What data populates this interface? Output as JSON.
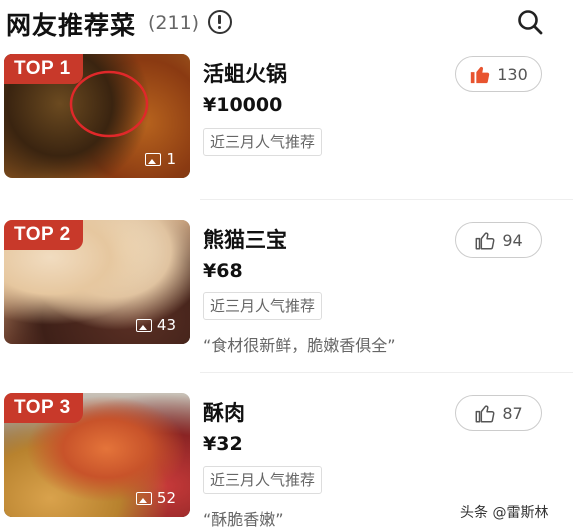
{
  "header": {
    "title": "网友推荐菜",
    "count": "(211)",
    "info_icon": "info-circle-icon",
    "search_icon": "search-icon"
  },
  "dishes": [
    {
      "rank": "TOP 1",
      "name": "活蛆火锅",
      "price": "¥10000",
      "tag": "近三月人气推荐",
      "quote": "",
      "photo_count": "1",
      "likes": "130",
      "liked": true
    },
    {
      "rank": "TOP 2",
      "name": "熊猫三宝",
      "price": "¥68",
      "tag": "近三月人气推荐",
      "quote": "“食材很新鲜，脆嫩香俱全”",
      "photo_count": "43",
      "likes": "94",
      "liked": false
    },
    {
      "rank": "TOP 3",
      "name": "酥肉",
      "price": "¥32",
      "tag": "近三月人气推荐",
      "quote": "“酥脆香嫩”",
      "photo_count": "52",
      "likes": "87",
      "liked": false
    }
  ],
  "watermark": "头条 @雷斯林",
  "colors": {
    "badge": "#c8392a",
    "like_active": "#e8542f",
    "like_inactive": "#555555"
  }
}
